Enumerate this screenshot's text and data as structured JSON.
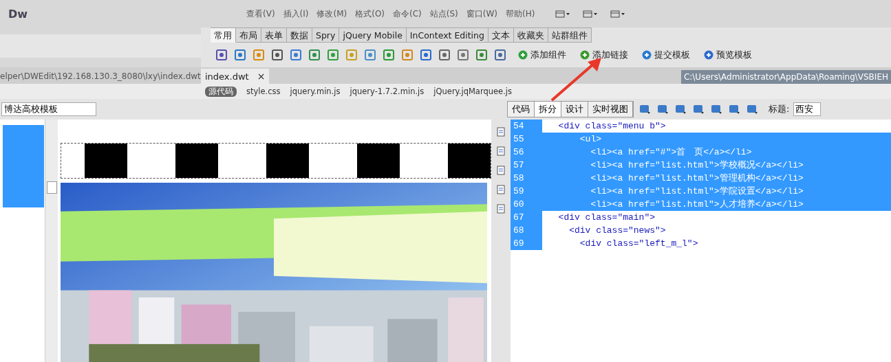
{
  "app": {
    "logo": "Dw"
  },
  "menu": [
    "查看(V)",
    "插入(I)",
    "修改(M)",
    "格式(O)",
    "命令(C)",
    "站点(S)",
    "窗口(W)",
    "帮助(H)"
  ],
  "insert_tabs": [
    {
      "label": "常用",
      "selected": true
    },
    {
      "label": "布局",
      "selected": false
    },
    {
      "label": "表单",
      "selected": false
    },
    {
      "label": "数据",
      "selected": false
    },
    {
      "label": "Spry",
      "selected": false
    },
    {
      "label": "jQuery Mobile",
      "selected": false
    },
    {
      "label": "InContext Editing",
      "selected": false
    },
    {
      "label": "文本",
      "selected": false
    },
    {
      "label": "收藏夹",
      "selected": false
    },
    {
      "label": "站群组件",
      "selected": false
    }
  ],
  "toolbar_buttons": [
    "添加组件",
    "添加链接",
    "提交模板",
    "预览模板"
  ],
  "left_path": "elper\\DWEdit\\192.168.130.3_8080\\lxy\\index.dwt",
  "document_tab": {
    "title": "index.dwt",
    "close": "×"
  },
  "right_path": "C:\\Users\\Administrator\\AppData\\Roaming\\VSBIEH",
  "related_files": [
    {
      "label": "源代码",
      "selected": true
    },
    {
      "label": "style.css",
      "selected": false
    },
    {
      "label": "jquery.min.js",
      "selected": false
    },
    {
      "label": "jquery-1.7.2.min.js",
      "selected": false
    },
    {
      "label": "jQuery.jqMarquee.js",
      "selected": false
    }
  ],
  "site_field": {
    "value": "博达高校模板"
  },
  "view_buttons": [
    {
      "label": "代码",
      "selected": false
    },
    {
      "label": "拆分",
      "selected": true
    },
    {
      "label": "设计",
      "selected": false
    },
    {
      "label": "实时视图",
      "selected": false
    }
  ],
  "title_field": {
    "label": "标题:",
    "value": "西安"
  },
  "code_lines": [
    {
      "number": "54",
      "code": "  <div class=\"menu b\">",
      "selected": false
    },
    {
      "number": "55",
      "code": "      <ul>",
      "selected": true
    },
    {
      "number": "56",
      "code": "        <li><a href=\"#\">首　页</a></li>",
      "selected": true
    },
    {
      "number": "57",
      "code": "        <li><a href=\"list.html\">学校概况</a></li>",
      "selected": true
    },
    {
      "number": "58",
      "code": "        <li><a href=\"list.html\">管理机构</a></li>",
      "selected": true
    },
    {
      "number": "59",
      "code": "        <li><a href=\"list.html\">学院设置</a></li>",
      "selected": true
    },
    {
      "number": "60",
      "code": "        <li><a href=\"list.html\">人才培养</a></li>",
      "selected": true
    },
    {
      "number": "67",
      "code": "  <div class=\"main\">",
      "selected": false
    },
    {
      "number": "68",
      "code": "    <div class=\"news\">",
      "selected": false
    },
    {
      "number": "69",
      "code": "      <div class=\"left_m_l\">",
      "selected": false
    }
  ]
}
